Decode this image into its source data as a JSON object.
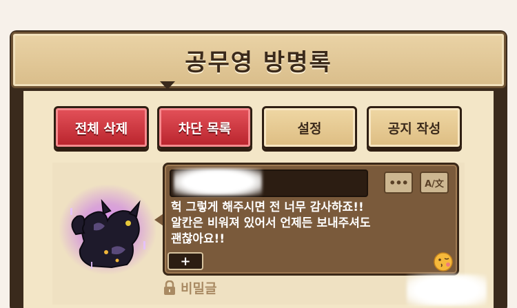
{
  "header": {
    "title": "공무영 방명록"
  },
  "toolbar": {
    "delete_all": "전체 삭제",
    "block_list": "차단 목록",
    "settings": "설정",
    "write_notice": "공지 작성"
  },
  "post": {
    "author_name": "",
    "message_lines": [
      "헉 그렇게 해주시면 전 너무 감사하죠!!",
      "알칸은 비워져 있어서 언제든 보내주셔도",
      "괜찮아요!!"
    ],
    "more_label": "•••",
    "translate_label": "A/文",
    "plus_label": "+",
    "secret_label": "비밀글"
  },
  "icons": {
    "more": "more-dots-icon",
    "translate": "translate-icon",
    "plus": "plus-icon",
    "lock": "lock-icon",
    "emoji": "kiss-emoji-icon"
  },
  "colors": {
    "red_button": "#c8323a",
    "tan_button": "#e6cc96",
    "bubble": "#7a5a3b",
    "frame": "#3a2a1c",
    "glow": "#c46af0"
  }
}
